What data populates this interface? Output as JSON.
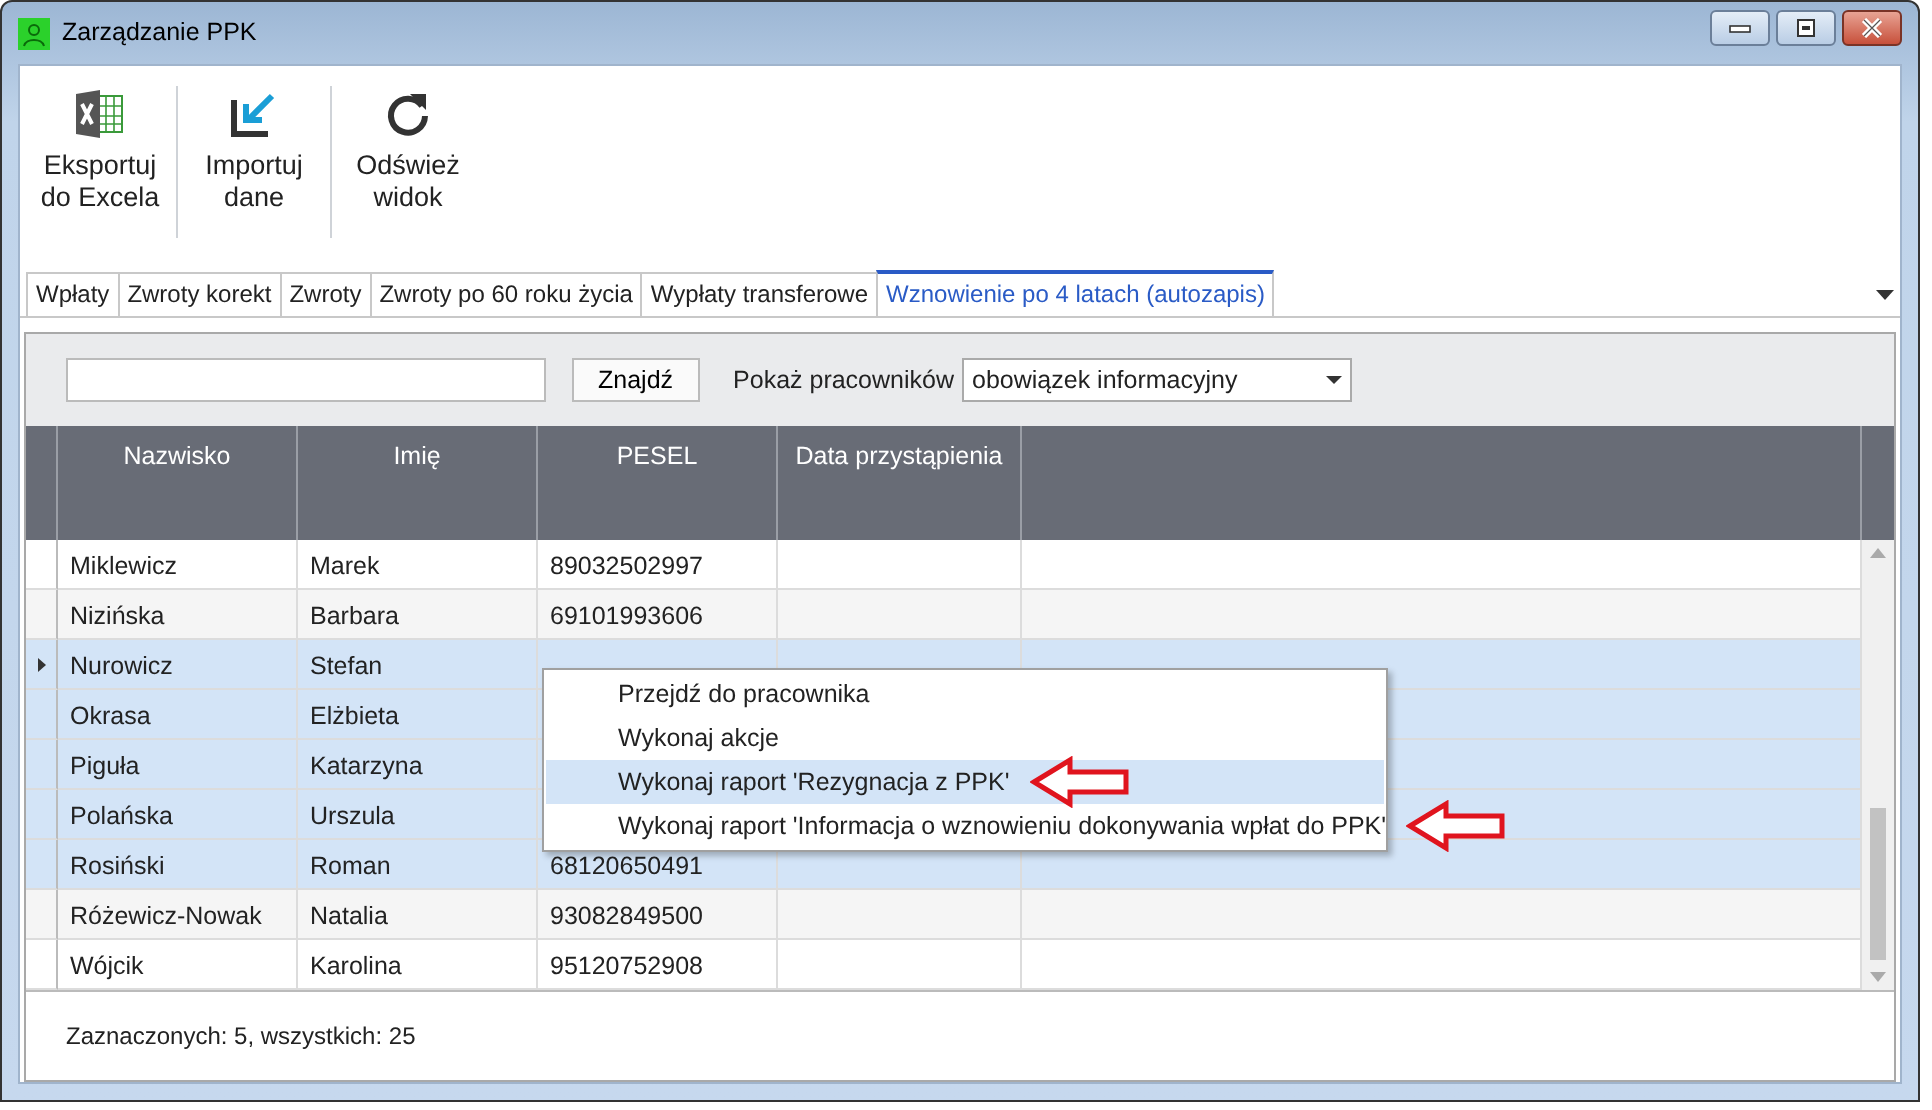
{
  "window": {
    "title": "Zarządzanie PPK"
  },
  "toolbar": [
    {
      "kind": "excel",
      "label": "Eksportuj\ndo Excela"
    },
    {
      "kind": "import",
      "label": "Importuj\ndane"
    },
    {
      "kind": "refresh",
      "label": "Odśwież\nwidok"
    }
  ],
  "tabs": [
    {
      "label": "Wpłaty",
      "selected": false
    },
    {
      "label": "Zwroty korekt",
      "selected": false
    },
    {
      "label": "Zwroty",
      "selected": false
    },
    {
      "label": "Zwroty po 60 roku życia",
      "selected": false
    },
    {
      "label": "Wypłaty transferowe",
      "selected": false
    },
    {
      "label": "Wznowienie po 4 latach (autozapis)",
      "selected": true
    }
  ],
  "filter": {
    "search_button": "Znajdź",
    "show_label": "Pokaż pracowników",
    "show_value": "obowiązek informacyjny"
  },
  "table": {
    "columns": [
      "Nazwisko",
      "Imię",
      "PESEL",
      "Data przystąpienia"
    ],
    "rows": [
      {
        "cells": [
          "Miklewicz",
          "Marek",
          "89032502997",
          ""
        ],
        "selected": false,
        "current": false
      },
      {
        "cells": [
          "Nizińska",
          "Barbara",
          "69101993606",
          ""
        ],
        "selected": false,
        "current": false
      },
      {
        "cells": [
          "Nurowicz",
          "Stefan",
          "",
          ""
        ],
        "selected": true,
        "current": true
      },
      {
        "cells": [
          "Okrasa",
          "Elżbieta",
          "",
          ""
        ],
        "selected": true,
        "current": false
      },
      {
        "cells": [
          "Piguła",
          "Katarzyna",
          "",
          ""
        ],
        "selected": true,
        "current": false
      },
      {
        "cells": [
          "Polańska",
          "Urszula",
          "",
          ""
        ],
        "selected": true,
        "current": false
      },
      {
        "cells": [
          "Rosiński",
          "Roman",
          "68120650491",
          ""
        ],
        "selected": true,
        "current": false
      },
      {
        "cells": [
          "Różewicz-Nowak",
          "Natalia",
          "93082849500",
          ""
        ],
        "selected": false,
        "current": false
      },
      {
        "cells": [
          "Wójcik",
          "Karolina",
          "95120752908",
          ""
        ],
        "selected": false,
        "current": false
      }
    ]
  },
  "context_menu": [
    {
      "label": "Przejdź do pracownika",
      "selected": false,
      "arrow": false
    },
    {
      "label": "Wykonaj akcje",
      "selected": false,
      "arrow": false
    },
    {
      "label": "Wykonaj raport 'Rezygnacja z PPK'",
      "selected": true,
      "arrow": true
    },
    {
      "label": "Wykonaj raport 'Informacja o wznowieniu dokonywania wpłat do PPK'",
      "selected": false,
      "arrow": true
    }
  ],
  "status_bar": "Zaznaczonych: 5, wszystkich: 25"
}
